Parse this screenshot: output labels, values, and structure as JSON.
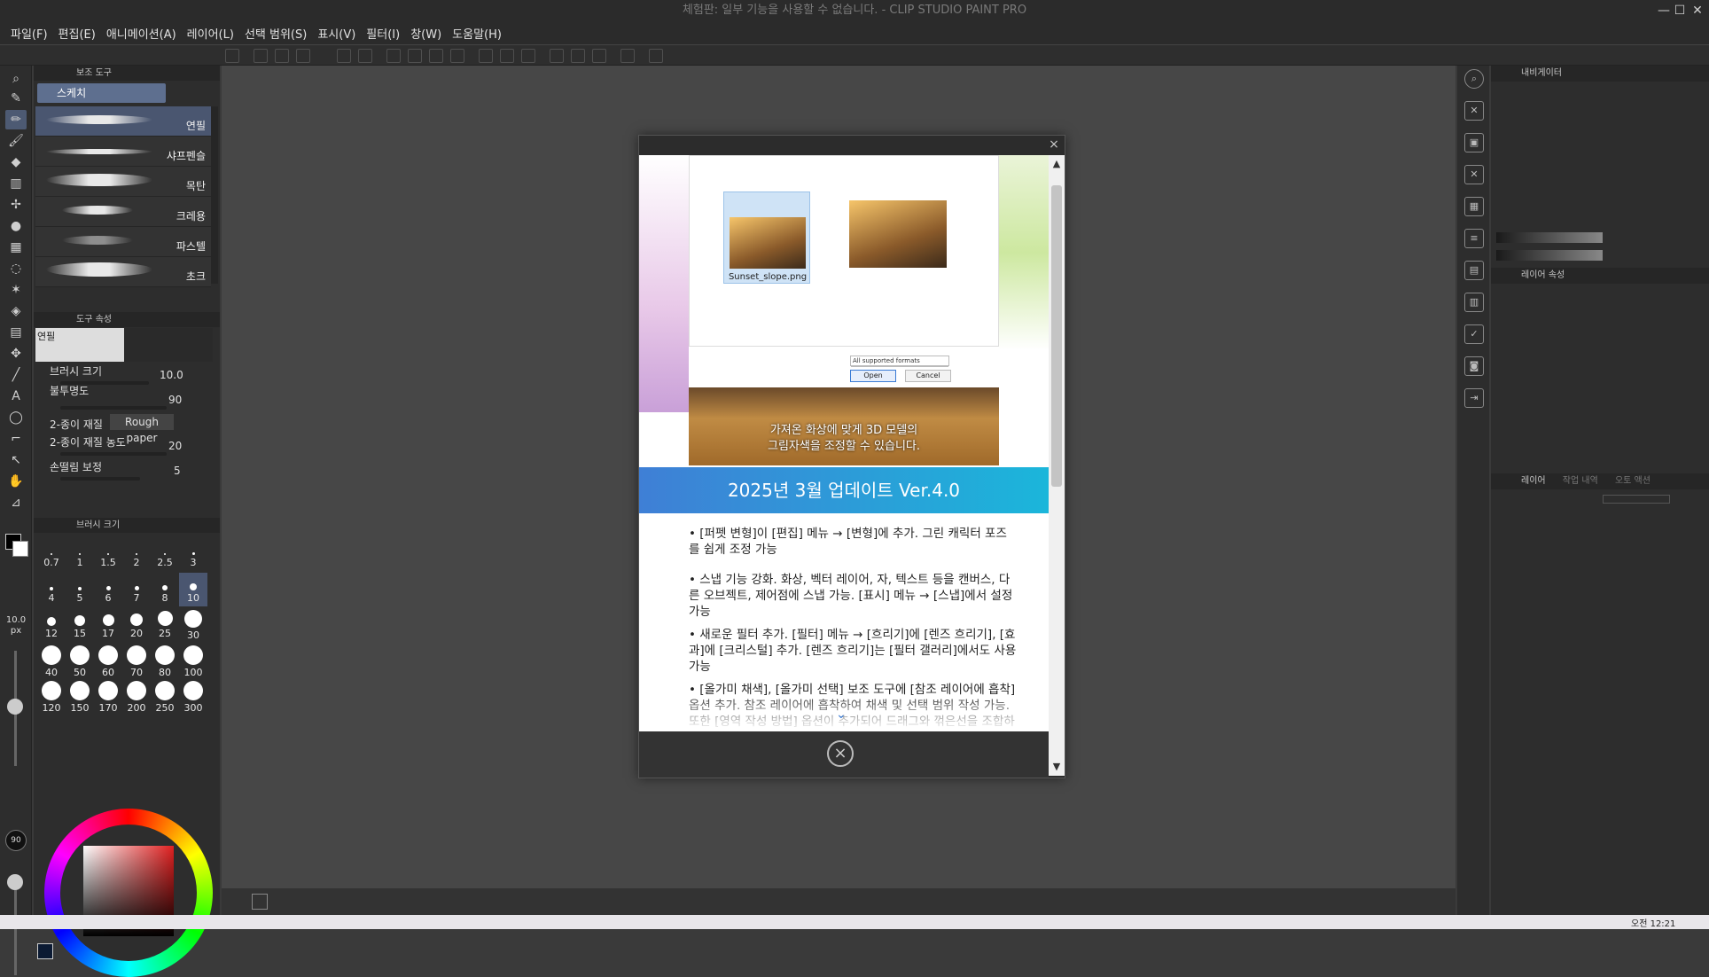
{
  "window": {
    "title": "체험판: 일부 기능을 사용할 수 없습니다. - CLIP STUDIO PAINT PRO",
    "minimize": "—",
    "maximize": "☐",
    "close": "✕"
  },
  "menu": [
    "파일(F)",
    "편집(E)",
    "애니메이션(A)",
    "레이어(L)",
    "선택 범위(S)",
    "표시(V)",
    "필터(I)",
    "창(W)",
    "도움말(H)"
  ],
  "subtool_panel": {
    "header": "보조 도구",
    "group": "스케치",
    "brushes": [
      "연필",
      "샤프펜슬",
      "목탄",
      "크레용",
      "파스텔",
      "초크"
    ]
  },
  "tool_property": {
    "header": "도구 속성",
    "preview_name": "연필",
    "brush_size_label": "브러시 크기",
    "brush_size_value": "10.0",
    "opacity_label": "불투명도",
    "opacity_value": "90",
    "paper_texture_label": "2-종이 재질",
    "paper_texture_value": "Rough paper",
    "paper_density_label": "2-종이 재질 농도",
    "paper_density_value": "20",
    "stabilization_label": "손떨림 보정",
    "stabilization_value": "5"
  },
  "brush_size_panel": {
    "header": "브러시 크기",
    "sizes": [
      "0.7",
      "1",
      "1.5",
      "2",
      "2.5",
      "3",
      "4",
      "5",
      "6",
      "7",
      "8",
      "10",
      "12",
      "15",
      "17",
      "20",
      "25",
      "30",
      "40",
      "50",
      "60",
      "70",
      "80",
      "100",
      "120",
      "150",
      "170",
      "200",
      "250",
      "300"
    ],
    "current_size": "10.0",
    "current_unit": "px",
    "opacity_readout": "90"
  },
  "right_panel": {
    "navigator_header": "내비게이터",
    "layer_property_header": "레이어 속성",
    "layer_header": "레이어",
    "layer_tabs": [
      "작업 내역",
      "오토 액션"
    ]
  },
  "dialog": {
    "close": "×",
    "file_name": "Sunset_slope.png",
    "format_select": "All supported formats",
    "open_button": "Open",
    "cancel_button": "Cancel",
    "caption": "가져온 화상에 맞게 3D 모델의\n그림자색을 조정할 수 있습니다.",
    "banner": "2025년 3월 업데이트 Ver.4.0",
    "bullets": [
      "• [퍼펫 변형]이 [편집] 메뉴 → [변형]에 추가. 그린 캐릭터 포즈를 쉽게 조정 가능",
      "• 스냅 기능 강화. 화상, 벡터 레이어, 자, 텍스트 등을 캔버스, 다른 오브젝트, 제어점에 스냅 가능. [표시] 메뉴 → [스냅]에서 설정 가능",
      "• 새로운 필터 추가. [필터] 메뉴 → [흐리기]에 [렌즈 흐리기], [효과]에 [크리스털] 추가. [렌즈 흐리기]는 [필터 갤러리]에서도 사용 가능",
      "• [올가미 채색], [올가미 선택] 보조 도구에 [참조 레이어에 흡착] 옵션 추가. 참조 레이어에 흡착하여 채색 및 선택 범위 작성 가능. 또한 [영역 작성 방법] 옵션이 추가되어 드래그와 꺾은선을 조합하여 선택 가능"
    ],
    "footer_close": "×"
  },
  "taskbar": {
    "clock": "오전 12:21"
  },
  "colors": {
    "accent_selected": "#5e6f8f",
    "banner_start": "#3f7fd6",
    "banner_end": "#1bb6da"
  }
}
